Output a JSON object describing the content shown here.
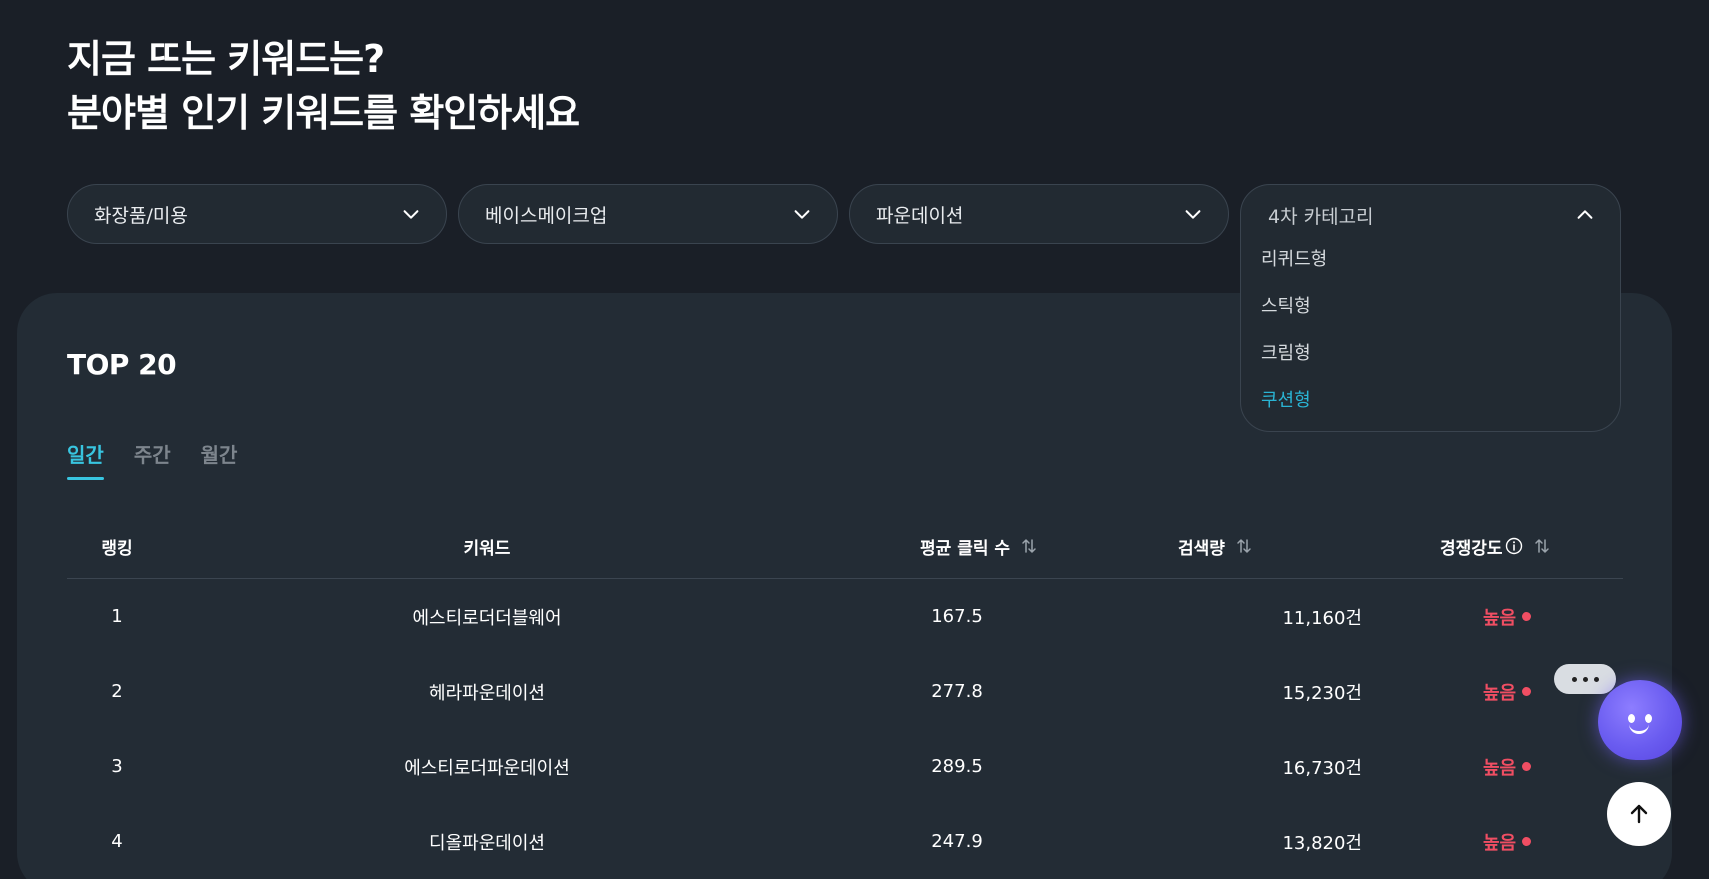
{
  "headline": {
    "line1": "지금 뜨는 키워드는?",
    "line2": "분야별 인기 키워드를 확인하세요"
  },
  "filters": {
    "category1": "화장품/미용",
    "category2": "베이스메이크업",
    "category3": "파운데이션",
    "category4": {
      "label": "4차 카테고리",
      "options": [
        "리퀴드형",
        "스틱형",
        "크림형",
        "쿠션형"
      ],
      "highlighted": "쿠션형"
    }
  },
  "panel": {
    "title": "TOP 20",
    "tabs": [
      {
        "label": "일간",
        "active": true
      },
      {
        "label": "주간",
        "active": false
      },
      {
        "label": "월간",
        "active": false
      }
    ]
  },
  "table": {
    "headers": {
      "rank": "랭킹",
      "keyword": "키워드",
      "avg_clicks": "평균 클릭 수",
      "search_volume": "검색량",
      "competition": "경쟁강도"
    },
    "rows": [
      {
        "rank": "1",
        "keyword": "에스티로더더블웨어",
        "avg_clicks": "167.5",
        "search_volume": "11,160건",
        "competition": "높음"
      },
      {
        "rank": "2",
        "keyword": "헤라파운데이션",
        "avg_clicks": "277.8",
        "search_volume": "15,230건",
        "competition": "높음"
      },
      {
        "rank": "3",
        "keyword": "에스티로더파운데이션",
        "avg_clicks": "289.5",
        "search_volume": "16,730건",
        "competition": "높음"
      },
      {
        "rank": "4",
        "keyword": "디올파운데이션",
        "avg_clicks": "247.9",
        "search_volume": "13,820건",
        "competition": "높음"
      }
    ]
  },
  "colors": {
    "background": "#1a1f27",
    "panel": "#232c35",
    "accent": "#38c5e0",
    "high": "#f04e63"
  },
  "icons": {
    "select_closed": "chevron-down-icon",
    "select_open": "chevron-up-icon",
    "sort": "sort-arrows-icon",
    "info": "info-icon",
    "chatbot": "chatbot-icon",
    "scroll_top": "arrow-up-icon"
  }
}
